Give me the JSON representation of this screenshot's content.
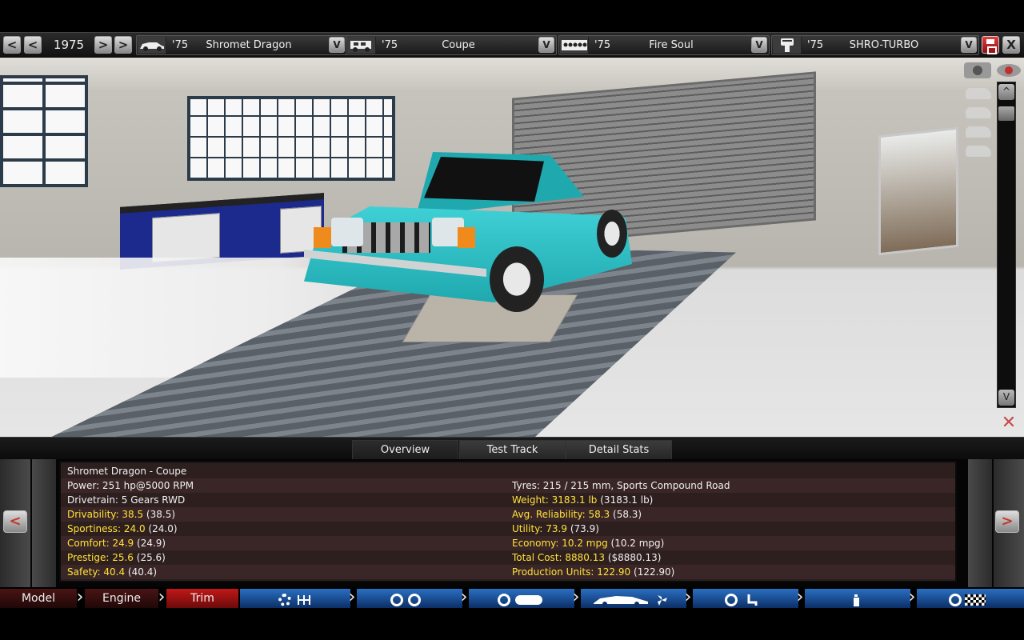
{
  "topbar": {
    "year": "1975",
    "prev_label": "<",
    "next_label": ">",
    "model": {
      "year": "'75",
      "name": "Shromet Dragon",
      "dropdown": "V"
    },
    "body": {
      "year": "'75",
      "name": "Coupe",
      "dropdown": "V"
    },
    "engine": {
      "year": "'75",
      "name": "Fire Soul",
      "dropdown": "V"
    },
    "turbo": {
      "year": "'75",
      "name": "SHRO-TURBO",
      "dropdown": "V"
    },
    "close_label": "X"
  },
  "viewport": {
    "scroll_up": "^",
    "scroll_down": "V",
    "reset_label": "✕"
  },
  "tabs": [
    {
      "label": "Overview",
      "active": true
    },
    {
      "label": "Test Track",
      "active": false
    },
    {
      "label": "Detail Stats",
      "active": false
    }
  ],
  "stats": {
    "title": "Shromet Dragon - Coupe",
    "left": [
      {
        "text": "Power: 251 hp@5000 RPM"
      },
      {
        "text": "Drivetrain: 5 Gears RWD"
      },
      {
        "label": "Drivability: 38.5",
        "value": "(38.5)"
      },
      {
        "label": "Sportiness: 24.0",
        "value": "(24.0)"
      },
      {
        "label": "Comfort: 24.9",
        "value": "(24.9)"
      },
      {
        "label": "Prestige: 25.6",
        "value": "(25.6)"
      },
      {
        "label": "Safety: 40.4",
        "value": "(40.4)"
      }
    ],
    "right": [
      {
        "text": "Tyres: 215 / 215 mm, Sports Compound Road"
      },
      {
        "label": "Weight: 3183.1 lb",
        "value": "(3183.1 lb)"
      },
      {
        "label": "Avg. Reliability: 58.3",
        "value": "(58.3)"
      },
      {
        "label": "Utility: 73.9",
        "value": "(73.9)"
      },
      {
        "label": "Economy: 10.2 mpg",
        "value": "(10.2 mpg)"
      },
      {
        "label": "Total Cost: 8880.13",
        "value": "($8880.13)"
      },
      {
        "label": "Production Units: 122.90",
        "value": "(122.90)"
      }
    ]
  },
  "panel_nav": {
    "prev": "<",
    "next": ">"
  },
  "bottom_nav": {
    "model": "Model",
    "engine": "Engine",
    "trim": "Trim"
  },
  "colors": {
    "highlight_text": "#ffe23a",
    "car_paint": "#2fc4c9",
    "active_step": "#c21717",
    "inactive_step": "#2a6fc0"
  }
}
